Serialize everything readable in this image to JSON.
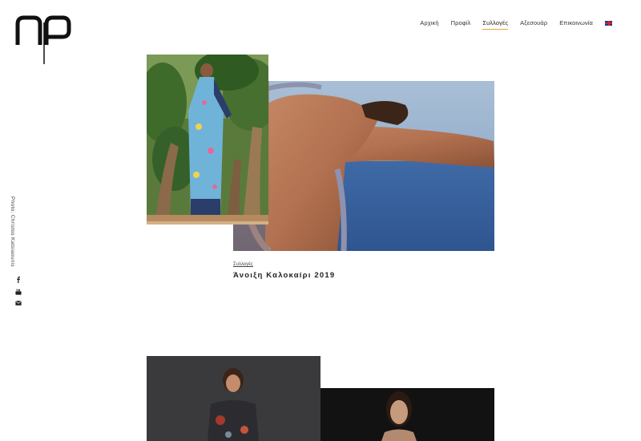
{
  "nav": {
    "items": [
      {
        "label": "Αρχική"
      },
      {
        "label": "Προφίλ"
      },
      {
        "label": "Συλλογές",
        "active": true
      },
      {
        "label": "Αξεσουάρ"
      },
      {
        "label": "Επικοινωνία"
      }
    ],
    "language_icon": "uk-flag-icon"
  },
  "sidebar": {
    "credit": "Photo: Christos Katsiaounis",
    "social_icons": [
      "facebook-icon",
      "youtube-icon",
      "email-icon"
    ]
  },
  "post": {
    "category": "Συλλογές",
    "title": "Άνοιξη Καλοκαίρι 2019"
  },
  "colors": {
    "accent": "#e7a33b",
    "text": "#222222"
  }
}
